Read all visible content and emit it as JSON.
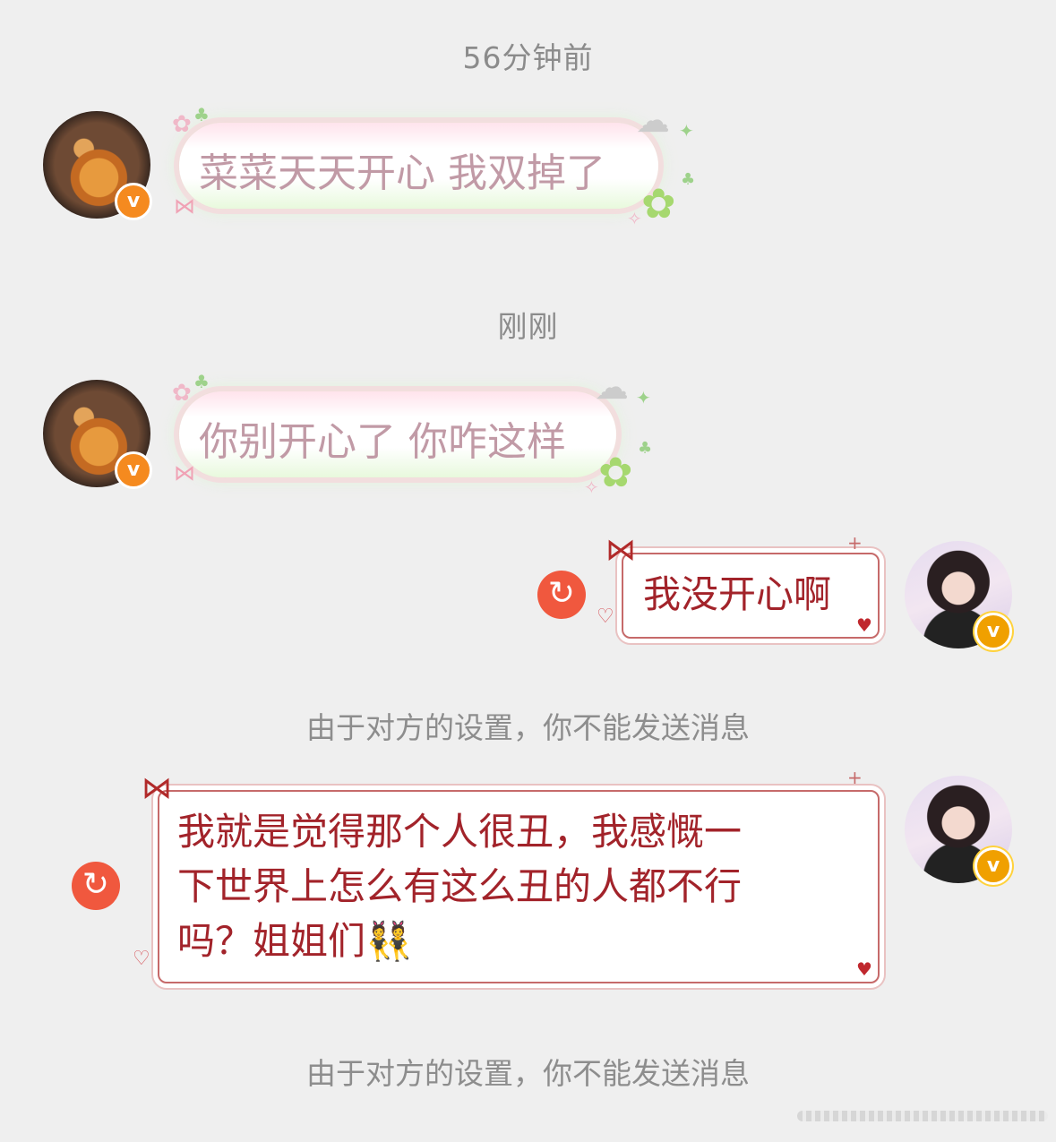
{
  "timestamps": [
    "56分钟前",
    "刚刚"
  ],
  "messages": [
    {
      "sender": "other",
      "text": "菜菜天天开心 我双掉了",
      "badge": "v"
    },
    {
      "sender": "other",
      "text": "你别开心了 你咋这样",
      "badge": "v"
    },
    {
      "sender": "self",
      "text": "我没开心啊",
      "badge": "v",
      "status": "failed"
    },
    {
      "sender": "self",
      "lines": [
        "我就是觉得那个人很丑，我感慨一",
        "下世界上怎么有这么丑的人都不行",
        "吗？姐姐们👯"
      ],
      "badge": "v",
      "status": "failed"
    }
  ],
  "system_notes": [
    "由于对方的设置，你不能发送消息",
    "由于对方的设置，你不能发送消息"
  ],
  "icons": {
    "retry": "retry-icon",
    "verified": "verified-badge-icon"
  },
  "colors": {
    "background": "#efefef",
    "cute_text": "#c19aa6",
    "bow_text": "#a2232a",
    "retry": "#f0583e",
    "badge": "#f58a1f"
  }
}
